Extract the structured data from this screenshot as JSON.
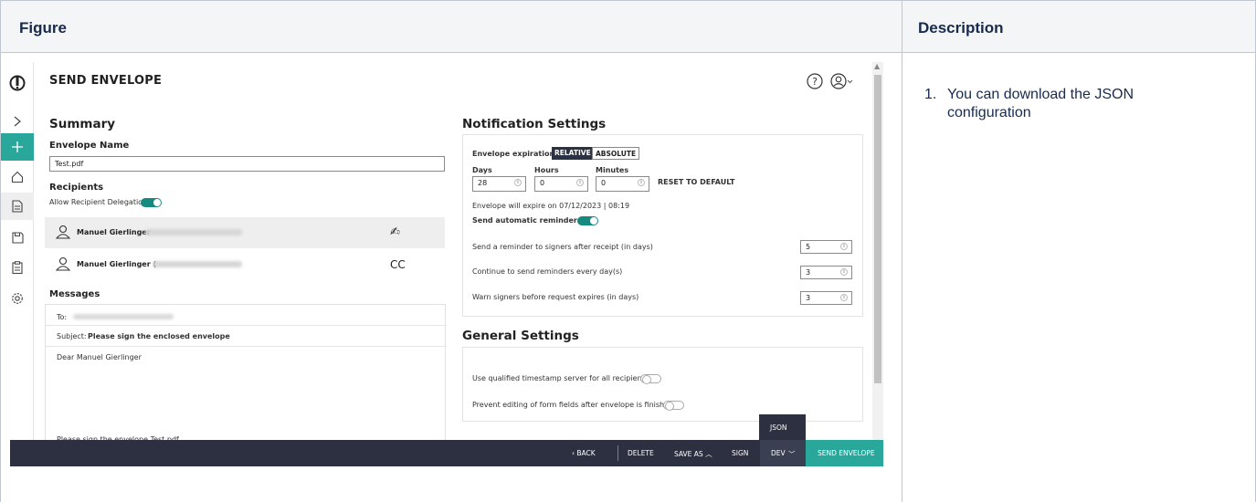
{
  "table": {
    "header_figure": "Figure",
    "header_description": "Description"
  },
  "description": {
    "items": [
      {
        "number": "1.",
        "text": "You can download the JSON configuration"
      }
    ]
  },
  "app": {
    "page_title": "SEND ENVELOPE",
    "summary": {
      "heading": "Summary",
      "envelope_name_label": "Envelope Name",
      "envelope_name_value": "Test.pdf",
      "recipients_label": "Recipients",
      "allow_delegation_label": "Allow Recipient Delegation",
      "allow_delegation_on": true,
      "recipients": [
        {
          "name": "Manuel Gierlinger",
          "role": "✍",
          "role_label": "sign"
        },
        {
          "name": "Manuel Gierlinger (",
          "role": "CC",
          "role_label": "cc"
        }
      ]
    },
    "messages": {
      "heading": "Messages",
      "to_label": "To:",
      "subject_label": "Subject:",
      "subject_value": "Please sign the enclosed envelope",
      "greeting": "Dear Manuel Gierlinger",
      "footer_text": "Please sign the envelope Test.pdf"
    },
    "notification": {
      "heading": "Notification Settings",
      "expiration_label": "Envelope expiration",
      "relative_label": "RELATIVE",
      "absolute_label": "ABSOLUTE",
      "days_label": "Days",
      "days_value": "28",
      "hours_label": "Hours",
      "hours_value": "0",
      "minutes_label": "Minutes",
      "minutes_value": "0",
      "reset_label": "RESET TO DEFAULT",
      "expire_text": "Envelope will expire on 07/12/2023 | 08:19",
      "auto_reminders_label": "Send automatic reminders",
      "auto_reminders_on": true,
      "reminder_after_label": "Send a reminder to signers after receipt (in days)",
      "reminder_after_value": "5",
      "reminder_every_label": "Continue to send reminders every day(s)",
      "reminder_every_value": "3",
      "warn_label": "Warn signers before request expires (in days)",
      "warn_value": "3"
    },
    "general": {
      "heading": "General Settings",
      "timestamp_label": "Use qualified timestamp server for all recipients",
      "timestamp_on": false,
      "prevent_label": "Prevent editing of form fields after envelope is finished",
      "prevent_on": false
    },
    "bottom_bar": {
      "back": "BACK",
      "delete": "DELETE",
      "save_as": "SAVE AS",
      "sign": "SIGN",
      "dev": "DEV",
      "send": "SEND ENVELOPE",
      "dropdown_item": "JSON"
    },
    "colors": {
      "accent": "#2aa79b",
      "bar": "#2c3040",
      "toggle_on": "#168a7f"
    }
  }
}
